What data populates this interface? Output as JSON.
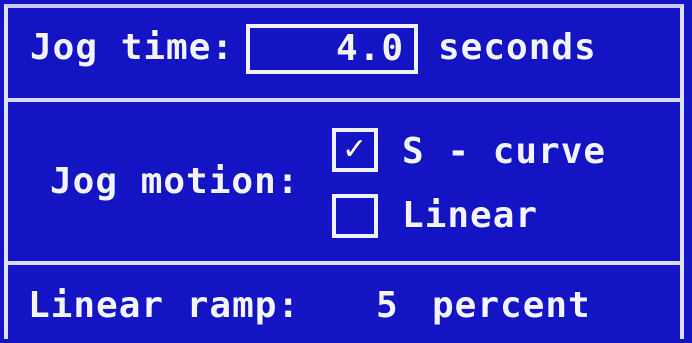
{
  "jog_time": {
    "label": "Jog time:",
    "value": "4.0",
    "units": "seconds"
  },
  "jog_motion": {
    "label": "Jog motion:",
    "options": [
      {
        "label": "S - curve",
        "checked": true,
        "mark": "✓"
      },
      {
        "label": "Linear",
        "checked": false,
        "mark": ""
      }
    ]
  },
  "linear_ramp": {
    "label": "Linear ramp:",
    "value": "5",
    "units": "percent"
  },
  "colors": {
    "background": "#1414c4",
    "foreground": "#f4f4ff",
    "border": "#e0e0ff"
  }
}
